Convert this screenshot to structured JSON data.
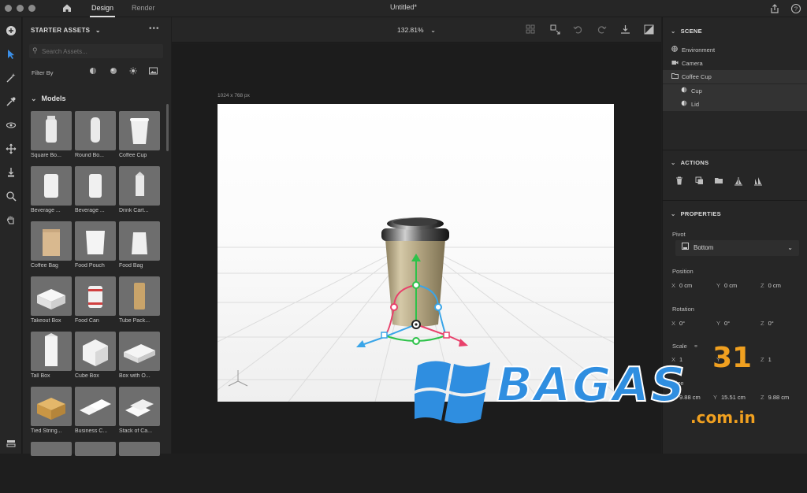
{
  "app": {
    "nav": {
      "design": "Design",
      "render": "Render"
    },
    "doc_title": "Untitled*"
  },
  "assets": {
    "header": "STARTER ASSETS",
    "search_placeholder": "Search Assets...",
    "filter_label": "Filter By",
    "section": "Models",
    "items": [
      {
        "label": "Square Bo..."
      },
      {
        "label": "Round Bo..."
      },
      {
        "label": "Coffee Cup"
      },
      {
        "label": "Beverage ..."
      },
      {
        "label": "Beverage ..."
      },
      {
        "label": "Drink Cart..."
      },
      {
        "label": "Coffee Bag"
      },
      {
        "label": "Food Pouch"
      },
      {
        "label": "Food Bag"
      },
      {
        "label": "Takeout Box"
      },
      {
        "label": "Food Can"
      },
      {
        "label": "Tube Pack..."
      },
      {
        "label": "Tall Box"
      },
      {
        "label": "Cube Box"
      },
      {
        "label": "Box with O..."
      },
      {
        "label": "Tied String..."
      },
      {
        "label": "Business C..."
      },
      {
        "label": "Stack of Ca..."
      }
    ]
  },
  "viewport": {
    "zoom": "132.81%",
    "canvas_size": "1024 x 768 px"
  },
  "scene": {
    "header": "SCENE",
    "items": [
      {
        "label": "Environment",
        "icon": "globe-icon"
      },
      {
        "label": "Camera",
        "icon": "camera-icon"
      },
      {
        "label": "Coffee Cup",
        "icon": "folder-icon"
      },
      {
        "label": "Cup",
        "icon": "model-icon"
      },
      {
        "label": "Lid",
        "icon": "model-icon"
      }
    ]
  },
  "actions": {
    "header": "ACTIONS"
  },
  "properties": {
    "header": "PROPERTIES",
    "pivot_label": "Pivot",
    "pivot_value": "Bottom",
    "position_label": "Position",
    "position": {
      "x": "0 cm",
      "y": "0 cm",
      "z": "0 cm"
    },
    "rotation_label": "Rotation",
    "rotation": {
      "x": "0°",
      "y": "0°",
      "z": "0°"
    },
    "scale_label": "Scale",
    "scale": {
      "x": "1",
      "y": "1",
      "z": "1"
    },
    "size_label": "Size",
    "size": {
      "x": "9.88 cm",
      "y": "15.51 cm",
      "z": "9.88 cm"
    }
  },
  "watermark": {
    "brand": "BAGAS",
    "number": "31",
    "domain": ".com.in"
  },
  "colors": {
    "accent": "#3a8ee6",
    "gizmo_green": "#2ec24a",
    "gizmo_blue": "#3aa5e8",
    "gizmo_red": "#e8416b"
  }
}
